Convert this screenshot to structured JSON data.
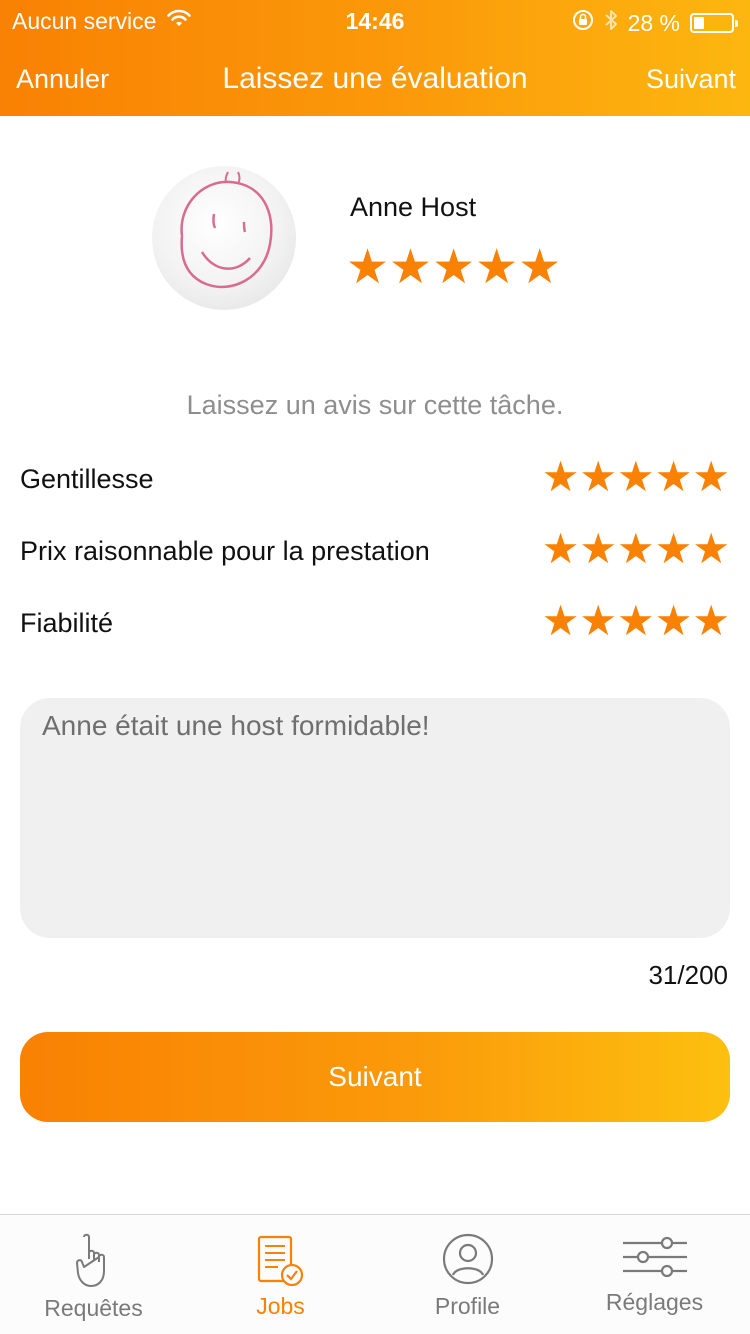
{
  "status_bar": {
    "carrier": "Aucun service",
    "time": "14:46",
    "battery": "28 %",
    "battery_level": 0.28,
    "icons": [
      "wifi-icon",
      "orientation-lock-icon",
      "bluetooth-icon",
      "battery-icon"
    ]
  },
  "nav": {
    "cancel_label": "Annuler",
    "title": "Laissez une évaluation",
    "next_label": "Suivant"
  },
  "host": {
    "name": "Anne Host",
    "rating": 5,
    "max_rating": 5
  },
  "prompt": "Laissez un avis sur cette tâche.",
  "criteria": [
    {
      "label": "Gentillesse",
      "rating": 5
    },
    {
      "label": "Prix raisonnable pour la prestation",
      "rating": 5
    },
    {
      "label": "Fiabilité",
      "rating": 5
    }
  ],
  "review": {
    "text": "Anne était une host formidable!",
    "counter": "31/200"
  },
  "cta_label": "Suivant",
  "tabs": [
    {
      "label": "Requêtes",
      "icon": "hand-pointing-icon",
      "active": false
    },
    {
      "label": "Jobs",
      "icon": "document-check-icon",
      "active": true
    },
    {
      "label": "Profile",
      "icon": "user-icon",
      "active": false
    },
    {
      "label": "Réglages",
      "icon": "sliders-icon",
      "active": false
    }
  ],
  "colors": {
    "accent": "#f98103",
    "accent_end": "#fcc00f",
    "muted_text": "#8e8e8e",
    "field_bg": "#eff0ef"
  }
}
